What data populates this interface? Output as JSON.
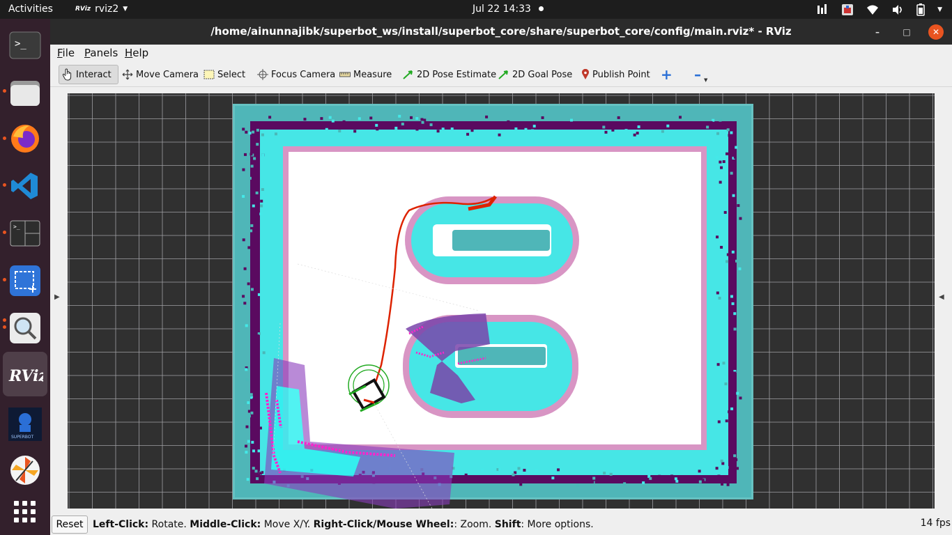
{
  "topbar": {
    "activities": "Activities",
    "app_name": "rviz2",
    "app_glyph": "RViz",
    "clock": "Jul 22  14:33",
    "tray_icons": [
      "accessibility-icon",
      "app-indicator-icon",
      "wifi-icon",
      "volume-icon",
      "battery-icon",
      "power-menu-icon"
    ]
  },
  "dock": {
    "items": [
      {
        "name": "terminal",
        "icon": "terminal-icon",
        "running": false
      },
      {
        "name": "files",
        "icon": "folder-icon",
        "running": true
      },
      {
        "name": "firefox",
        "icon": "firefox-icon",
        "running": true
      },
      {
        "name": "vscode",
        "icon": "vscode-icon",
        "running": true
      },
      {
        "name": "terminator",
        "icon": "split-terminal-icon",
        "running": true
      },
      {
        "name": "screenshot",
        "icon": "screenshot-icon",
        "running": true
      },
      {
        "name": "image-viewer",
        "icon": "magnifier-icon",
        "running": true
      },
      {
        "name": "rviz",
        "icon": "rviz-icon",
        "label": "RViz",
        "running": true
      },
      {
        "name": "superbot",
        "icon": "superbot-icon",
        "label": "SUPERBOT",
        "running": false
      },
      {
        "name": "pinwheel",
        "icon": "pinwheel-icon",
        "running": false
      },
      {
        "name": "show-apps",
        "icon": "app-grid-icon",
        "running": false
      }
    ]
  },
  "window": {
    "title": "/home/ainunnajibk/superbot_ws/install/superbot_core/share/superbot_core/config/main.rviz* - RViz",
    "controls": {
      "minimize": "–",
      "maximize": "□",
      "close": "✕"
    }
  },
  "menubar": {
    "items": [
      {
        "label_key": "F",
        "label_rest": "ile"
      },
      {
        "label_key": "P",
        "label_rest": "anels"
      },
      {
        "label_key": "H",
        "label_rest": "elp"
      }
    ]
  },
  "toolbar": {
    "interact": "Interact",
    "move_camera": "Move Camera",
    "select": "Select",
    "focus_camera": "Focus Camera",
    "measure": "Measure",
    "pose_estimate": "2D Pose Estimate",
    "goal_pose": "2D Goal Pose",
    "publish_point": "Publish Point",
    "add_tool": "+",
    "remove_tool": "–"
  },
  "statusbar": {
    "reset": "Reset",
    "hint": [
      {
        "b": "Left-Click:",
        "t": " Rotate. "
      },
      {
        "b": "Middle-Click:",
        "t": " Move X/Y. "
      },
      {
        "b": "Right-Click/Mouse Wheel:",
        "t": ": Zoom. "
      },
      {
        "b": "Shift",
        "t": ": More options."
      }
    ],
    "fps": "14 fps"
  },
  "viewport": {
    "displays": [
      "grid",
      "map",
      "global-costmap",
      "local-costmap",
      "laser-scan",
      "robot-model",
      "planned-path"
    ],
    "colors": {
      "background": "#303030",
      "grid": "#a0a0a4",
      "map_free": "#ffffff",
      "costmap_inflation": "#44e8e8",
      "costmap_outer": "#4ab8b8",
      "lethal": "#5a0a60",
      "inscribed": "#cc88bb",
      "local_costmap": "#7a44aa",
      "scan": "#ff22cc",
      "path": "#dd2200",
      "robot_footprint": "#22aa22"
    }
  }
}
